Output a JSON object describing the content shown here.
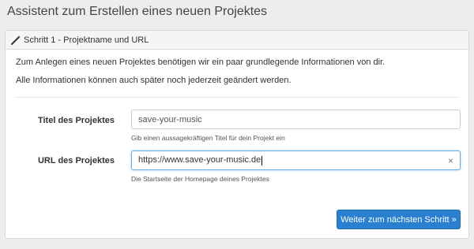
{
  "page": {
    "title": "Assistent zum Erstellen eines neuen Projektes"
  },
  "panel": {
    "heading": "Schritt 1 - Projektname und URL",
    "heading_icon": "magic-wand-icon",
    "intro_line1": "Zum Anlegen eines neuen Projektes benötigen wir ein paar grundlegende Informationen von dir.",
    "intro_line2": "Alle Informationen können auch später noch jederzeit geändert werden."
  },
  "form": {
    "title_label": "Titel des Projektes",
    "title_value": "save-your-music",
    "title_help": "Gib einen aussagekräftigen Titel für dein Projekt ein",
    "url_label": "URL des Projektes",
    "url_value": "https://www.save-your-music.de",
    "url_help": "Die Startseite der Homepage deines Projektes",
    "clear_symbol": "×"
  },
  "actions": {
    "next_label": "Weiter zum nächsten Schritt »"
  },
  "colors": {
    "accent": "#2a7fcf",
    "focus_border": "#66afe9"
  }
}
